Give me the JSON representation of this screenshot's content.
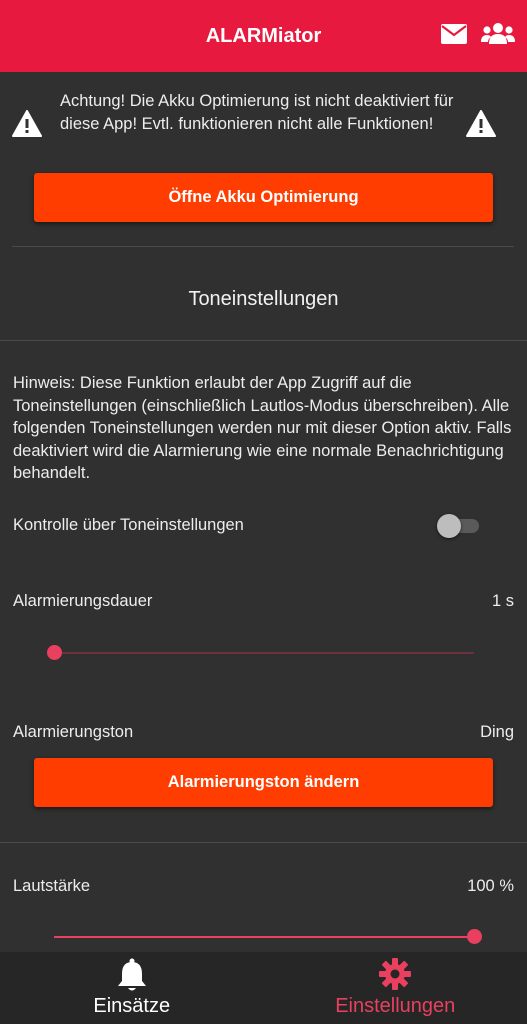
{
  "appbar": {
    "title": "ALARMiator",
    "accent_color": "#e8193f",
    "icons": [
      "mail-icon",
      "groups-icon"
    ]
  },
  "warning": {
    "text": "Achtung! Die Akku Optimierung ist nicht deaktiviert für diese App! Evtl. funktionieren nicht alle Funktionen!",
    "icon": "warning-icon",
    "button_label": "Öffne Akku Optimierung"
  },
  "tone_settings": {
    "title": "Toneinstellungen",
    "hint": "Hinweis: Diese Funktion erlaubt der App Zugriff auf die Toneinstellungen (einschließlich Lautlos-Modus überschreiben). Alle folgenden Toneinstellungen werden nur mit dieser Option aktiv. Falls deaktiviert wird die Alarmierung wie eine normale Benachrichtigung behandelt.",
    "control_label": "Kontrolle über Toneinstellungen",
    "control_enabled": false,
    "duration_label": "Alarmierungsdauer",
    "duration_value": "1 s",
    "duration_fraction": 0.0,
    "tone_label": "Alarmierungston",
    "tone_value": "Ding",
    "tone_button_label": "Alarmierungston ändern",
    "volume_label": "Lautstärke",
    "volume_value": "100 %",
    "volume_fraction": 1.0
  },
  "bottom_nav": {
    "items": [
      {
        "label": "Einsätze",
        "icon": "bell-icon",
        "active": false,
        "color": "#ffffff"
      },
      {
        "label": "Einstellungen",
        "icon": "gear-icon",
        "active": true,
        "color": "#e8405e"
      }
    ]
  },
  "colors": {
    "background": "#303030",
    "button": "#ff3d00",
    "slider": "#e8405e"
  }
}
